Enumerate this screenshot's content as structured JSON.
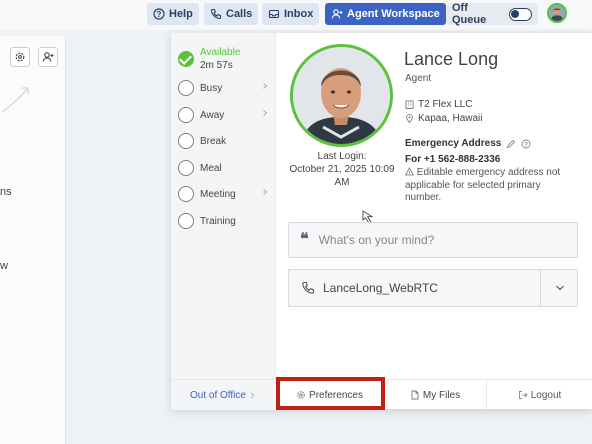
{
  "topbar": {
    "help": "Help",
    "calls": "Calls",
    "inbox": "Inbox",
    "agent_workspace": "Agent Workspace",
    "off_queue": "Off Queue"
  },
  "left_panel": {
    "text1": "ns",
    "text2": "w"
  },
  "status": {
    "available_label": "Available",
    "available_time": "2m 57s",
    "items": [
      "Busy",
      "Away",
      "Break",
      "Meal",
      "Meeting",
      "Training"
    ]
  },
  "profile": {
    "name": "Lance Long",
    "role": "Agent",
    "company": "T2 Flex LLC",
    "location": "Kapaa, Hawaii",
    "last_login_label": "Last Login:",
    "last_login_value": "October 21, 2025 10:09 AM",
    "emergency_title": "Emergency Address",
    "emergency_phone": "For +1 562-888-2336",
    "emergency_note": "Editable emergency address not applicable for selected primary number."
  },
  "mind_placeholder": "What's on your mind?",
  "phone_device": "LanceLong_WebRTC",
  "footer": {
    "out_of_office": "Out of Office",
    "preferences": "Preferences",
    "my_files": "My Files",
    "logout": "Logout"
  },
  "colors": {
    "accent": "#3c63c4",
    "available": "#5cc13b",
    "highlight": "#c01f16"
  }
}
